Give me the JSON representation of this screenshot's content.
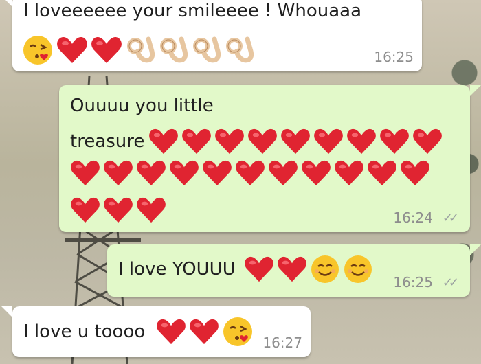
{
  "messages": [
    {
      "direction": "incoming",
      "text": "I loveeeeee your smileeee ! Whouaaa",
      "time": "16:25",
      "emojis": [
        "kiss",
        "heart",
        "heart",
        "ok",
        "ok",
        "ok",
        "ok"
      ]
    },
    {
      "direction": "outgoing",
      "text_line1": "Ouuuu you little",
      "text_line2": "treasure",
      "time": "16:24",
      "ticks": "✓✓",
      "emojis_row1": [
        "heart",
        "heart",
        "heart",
        "heart",
        "heart",
        "heart",
        "heart",
        "heart",
        "heart"
      ],
      "emojis_row2": [
        "heart",
        "heart",
        "heart",
        "heart",
        "heart",
        "heart",
        "heart",
        "heart",
        "heart",
        "heart",
        "heart"
      ],
      "emojis_row3": [
        "heart",
        "heart",
        "heart"
      ]
    },
    {
      "direction": "outgoing",
      "text": "I love YOUUU",
      "time": "16:25",
      "ticks": "✓✓",
      "emojis": [
        "heart",
        "heart",
        "smile",
        "smile"
      ]
    },
    {
      "direction": "incoming",
      "text": "I love u toooo",
      "time": "16:27",
      "emojis": [
        "heart",
        "heart",
        "kiss"
      ]
    }
  ],
  "colors": {
    "incoming_bubble": "#ffffff",
    "outgoing_bubble": "#e2f9c9",
    "heart": "#e02431",
    "emoji_face": "#f8c52a"
  }
}
